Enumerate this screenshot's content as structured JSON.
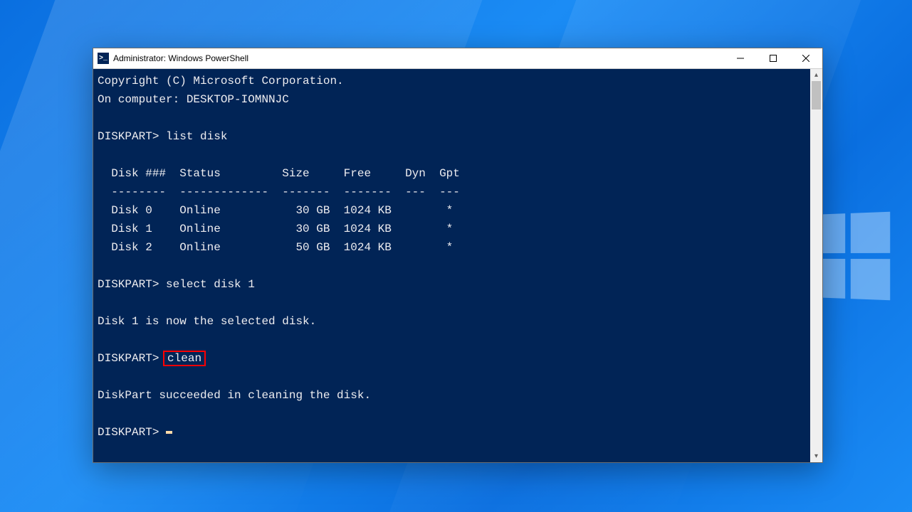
{
  "window": {
    "title": "Administrator: Windows PowerShell",
    "icon_glyph": ">_"
  },
  "terminal": {
    "copyright": "Copyright (C) Microsoft Corporation.",
    "on_computer": "On computer: DESKTOP-IOMNNJC",
    "prompt": "DISKPART>",
    "cmd_list_disk": "list disk",
    "table": {
      "header": "  Disk ###  Status         Size     Free     Dyn  Gpt",
      "divider": "  --------  -------------  -------  -------  ---  ---",
      "rows": [
        "  Disk 0    Online           30 GB  1024 KB        *",
        "  Disk 1    Online           30 GB  1024 KB        *",
        "  Disk 2    Online           50 GB  1024 KB        *"
      ]
    },
    "cmd_select": "select disk 1",
    "msg_selected": "Disk 1 is now the selected disk.",
    "cmd_clean": "clean",
    "msg_cleaned": "DiskPart succeeded in cleaning the disk."
  },
  "highlight": {
    "target": "clean",
    "color": "#ff0000"
  }
}
